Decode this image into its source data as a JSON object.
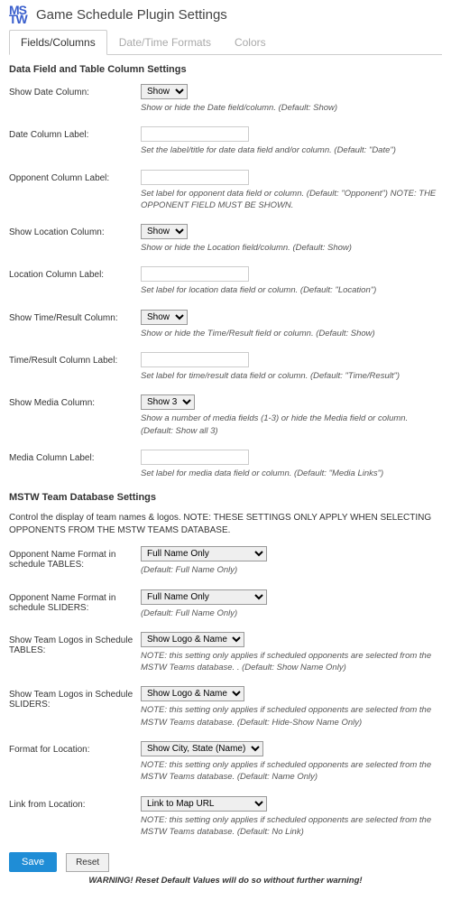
{
  "header": {
    "logo_top": "MS",
    "logo_bottom": "TW",
    "title": "Game Schedule Plugin Settings"
  },
  "tabs": {
    "fields": "Fields/Columns",
    "datetime": "Date/Time Formats",
    "colors": "Colors"
  },
  "section1": {
    "heading": "Data Field and Table Column Settings",
    "rows": {
      "show_date": {
        "label": "Show Date Column:",
        "value": "Show",
        "desc": "Show or hide the Date field/column. (Default: Show)"
      },
      "date_label": {
        "label": "Date Column Label:",
        "value": "",
        "desc": "Set the label/title for date data field and/or column. (Default: \"Date\")"
      },
      "opponent_label": {
        "label": "Opponent Column Label:",
        "value": "",
        "desc": "Set label for opponent data field or column. (Default: \"Opponent\") NOTE: THE OPPONENT FIELD MUST BE SHOWN."
      },
      "show_location": {
        "label": "Show Location Column:",
        "value": "Show",
        "desc": "Show or hide the Location field/column. (Default: Show)"
      },
      "location_label": {
        "label": "Location Column Label:",
        "value": "",
        "desc": "Set label for location data field or column. (Default: \"Location\")"
      },
      "show_time": {
        "label": "Show Time/Result Column:",
        "value": "Show",
        "desc": "Show or hide the Time/Result field or column. (Default: Show)"
      },
      "time_label": {
        "label": "Time/Result Column Label:",
        "value": "",
        "desc": "Set label for time/result data field or column. (Default: \"Time/Result\")"
      },
      "show_media": {
        "label": "Show Media Column:",
        "value": "Show 3",
        "desc": "Show a number of media fields (1-3) or hide the Media field or column. (Default: Show all 3)"
      },
      "media_label": {
        "label": "Media Column Label:",
        "value": "",
        "desc": "Set label for media data field or column. (Default: \"Media Links\")"
      }
    }
  },
  "section2": {
    "heading": "MSTW Team Database Settings",
    "intro": "Control the display of team names & logos. NOTE: THESE SETTINGS ONLY APPLY WHEN SELECTING OPPONENTS FROM THE MSTW TEAMS DATABASE.",
    "rows": {
      "opp_tables": {
        "label": "Opponent Name Format in schedule TABLES:",
        "value": "Full Name Only",
        "desc": "(Default: Full Name Only)"
      },
      "opp_sliders": {
        "label": "Opponent Name Format in schedule SLIDERS:",
        "value": "Full Name Only",
        "desc": "(Default: Full Name Only)"
      },
      "logo_tables": {
        "label": "Show Team Logos in Schedule TABLES:",
        "value": "Show Logo & Name",
        "desc": "NOTE: this setting only applies if scheduled opponents are selected from the MSTW Teams database. . (Default: Show Name Only)"
      },
      "logo_sliders": {
        "label": "Show Team Logos in Schedule SLIDERS:",
        "value": "Show Logo & Name",
        "desc": "NOTE: this setting only applies if scheduled opponents are selected from the MSTW Teams database. (Default: Hide-Show Name Only)"
      },
      "format_location": {
        "label": "Format for Location:",
        "value": "Show City, State (Name)",
        "desc": "NOTE: this setting only applies if scheduled opponents are selected from the MSTW Teams database. (Default: Name Only)"
      },
      "link_location": {
        "label": "Link from Location:",
        "value": "Link to Map URL",
        "desc": "NOTE: this setting only applies if scheduled opponents are selected from the MSTW Teams database. (Default: No Link)"
      }
    }
  },
  "buttons": {
    "save": "Save",
    "reset": "Reset"
  },
  "warning": "WARNING! Reset Default Values will do so without further warning!"
}
